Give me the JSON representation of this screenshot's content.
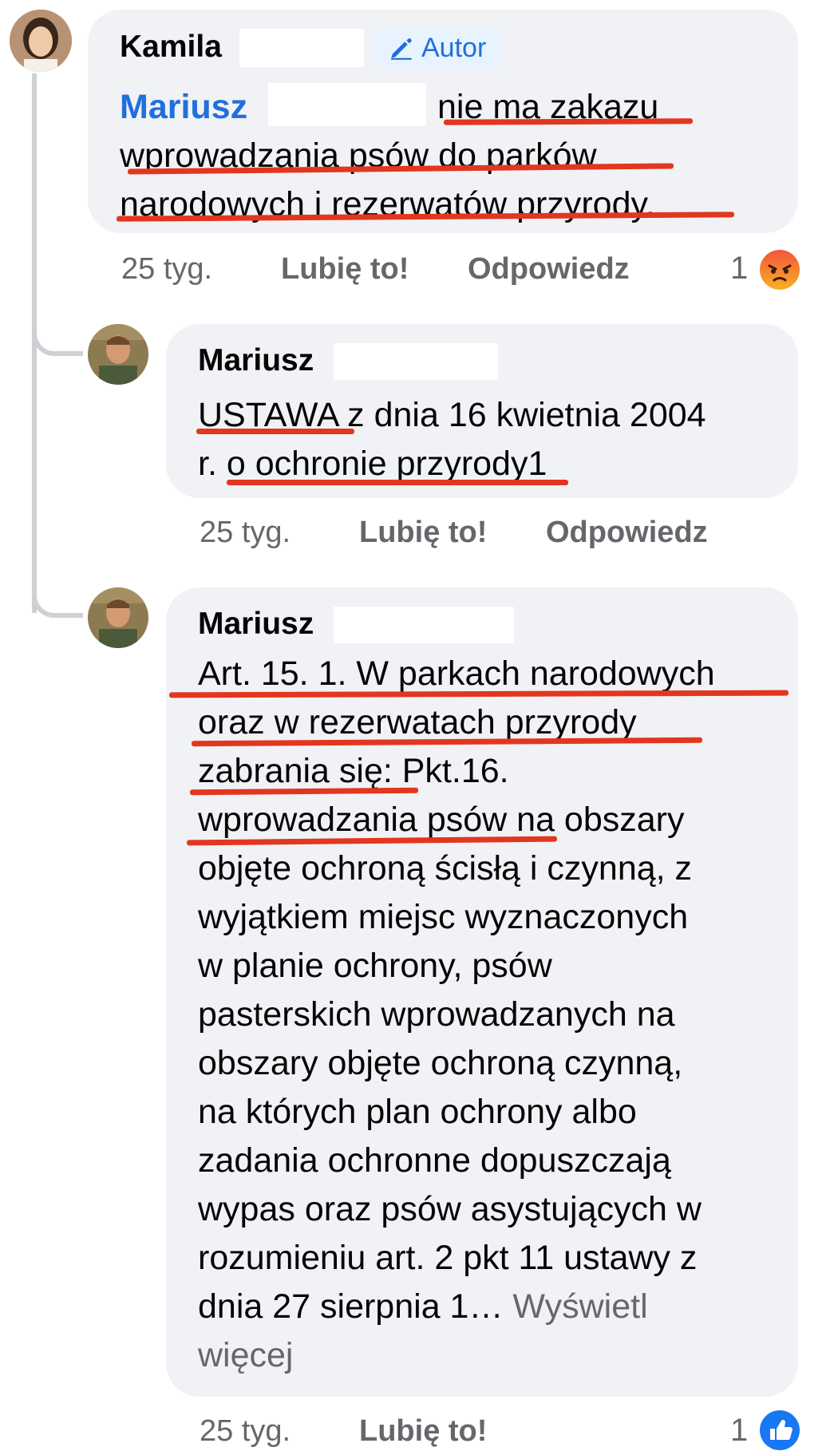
{
  "comments": [
    {
      "author": "Kamila",
      "badge": "Autor",
      "mention": "Mariusz",
      "lines": [
        "nie ma zakazu",
        "wprowadzania psów do parków",
        "narodowych i rezerwatów przyrody."
      ],
      "time": "25 tyg.",
      "like": "Lubię to!",
      "reply": "Odpowiedz",
      "reaction_count": "1",
      "reaction_icon": "angry-reaction-icon",
      "reaction_color": "#f5533d"
    },
    {
      "author": "Mariusz",
      "lines": [
        "USTAWA z dnia 16 kwietnia 2004",
        "r. o ochronie przyrody1"
      ],
      "time": "25 tyg.",
      "like": "Lubię to!",
      "reply": "Odpowiedz"
    },
    {
      "author": "Mariusz",
      "lines": [
        "Art. 15. 1. W parkach narodowych",
        "oraz w rezerwatach przyrody",
        "zabrania się: Pkt.16.",
        "wprowadzania psów na obszary",
        "objęte ochroną ścisłą i czynną, z",
        "wyjątkiem miejsc wyznaczonych",
        "w planie ochrony, psów",
        "pasterskich wprowadzanych na",
        "obszary objęte ochroną czynną,",
        "na których plan ochrony albo",
        "zadania ochronne dopuszczają",
        "wypas oraz psów asystujących w",
        "rozumieniu art. 2 pkt 11 ustawy z",
        "dnia 27 sierpnia 1…"
      ],
      "see_more": "Wyświetl",
      "see_more_2": "więcej",
      "time": "25 tyg.",
      "like": "Lubię to!",
      "reaction_count": "1",
      "reaction_icon": "like-reaction-icon",
      "reaction_color": "#1877f2"
    }
  ],
  "colors": {
    "bubble": "#f0f2f5",
    "annotation_red": "#e3361f",
    "link_blue": "#216fdb",
    "meta_gray": "#65676b"
  }
}
